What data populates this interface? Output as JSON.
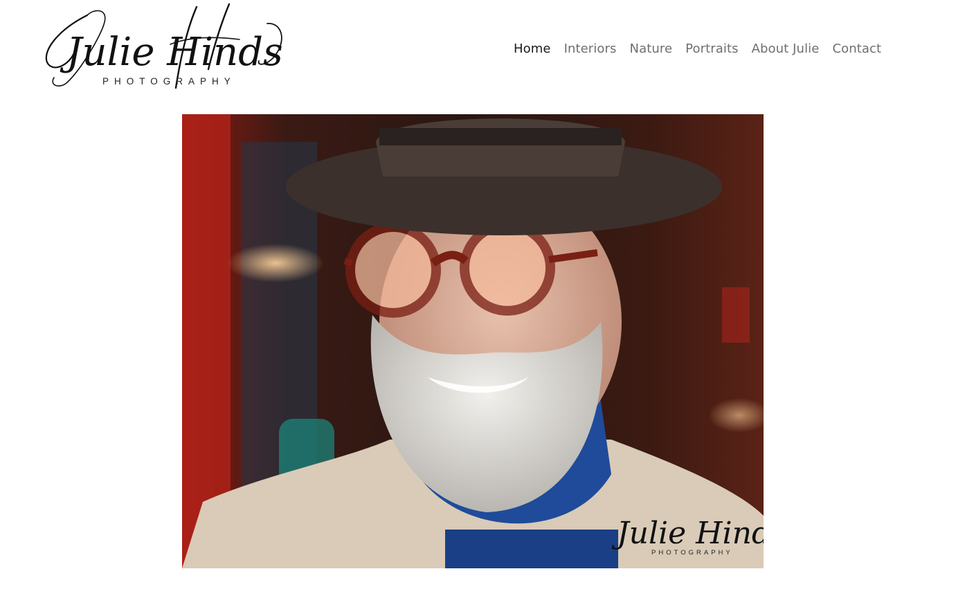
{
  "brand": {
    "logo_name": "Julie Hinds",
    "logo_tagline": "PHOTOGRAPHY"
  },
  "nav": {
    "items": [
      {
        "label": "Home",
        "active": true
      },
      {
        "label": "Interiors",
        "active": false
      },
      {
        "label": "Nature",
        "active": false
      },
      {
        "label": "Portraits",
        "active": false
      },
      {
        "label": "About Julie",
        "active": false
      },
      {
        "label": "Contact",
        "active": false
      }
    ]
  },
  "hero": {
    "watermark_name": "Julie Hinds",
    "watermark_tagline": "PHOTOGRAPHY"
  },
  "colors": {
    "nav_text": "#6f6f6f",
    "nav_active": "#1a1a1a",
    "background": "#ffffff"
  }
}
